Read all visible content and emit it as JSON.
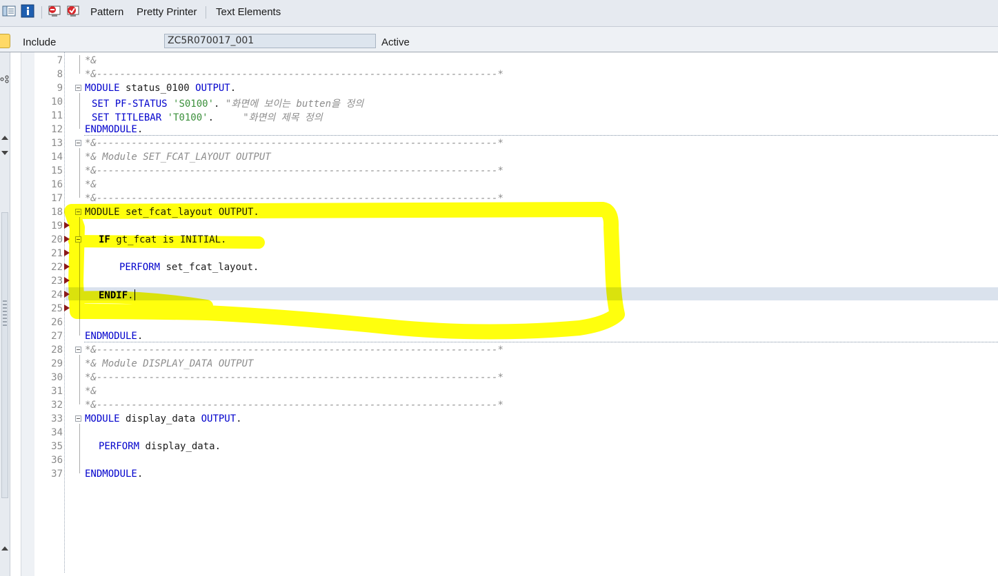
{
  "toolbar": {
    "icons": [
      "display-object-list-icon",
      "info-icon",
      "check-syntax-icon",
      "activate-icon"
    ],
    "pattern_label": "Pattern",
    "pretty_printer_label": "Pretty Printer",
    "text_elements_label": "Text Elements"
  },
  "header": {
    "include_label": "Include",
    "include_value": "ZC5R070017_001",
    "status": "Active"
  },
  "editor": {
    "lines": [
      {
        "num": "7"
      },
      {
        "num": "8"
      },
      {
        "num": "9"
      },
      {
        "num": "10"
      },
      {
        "num": "11"
      },
      {
        "num": "12"
      },
      {
        "num": "13"
      },
      {
        "num": "14"
      },
      {
        "num": "15"
      },
      {
        "num": "16"
      },
      {
        "num": "17"
      },
      {
        "num": "18"
      },
      {
        "num": "19"
      },
      {
        "num": "20"
      },
      {
        "num": "21"
      },
      {
        "num": "22"
      },
      {
        "num": "23"
      },
      {
        "num": "24"
      },
      {
        "num": "25"
      },
      {
        "num": "26"
      },
      {
        "num": "27"
      },
      {
        "num": "28"
      },
      {
        "num": "29"
      },
      {
        "num": "30"
      },
      {
        "num": "31"
      },
      {
        "num": "32"
      },
      {
        "num": "33"
      },
      {
        "num": "34"
      },
      {
        "num": "35"
      },
      {
        "num": "36"
      },
      {
        "num": "37"
      }
    ],
    "code": {
      "l7": "*&",
      "l8": "*&---------------------------------------------------------------------*",
      "l9_kw1": "MODULE",
      "l9_name": " status_0100 ",
      "l9_kw2": "OUTPUT",
      "l9_dot": ".",
      "l10_kw1": "SET",
      "l10_kw2": " PF-STATUS ",
      "l10_str": "'S0100'",
      "l10_dot": ". ",
      "l10_cmt": "\"화면에 보이는 butten을 정의",
      "l11_kw1": "SET",
      "l11_kw2": " TITLEBAR ",
      "l11_str": "'T0100'",
      "l11_dot": ".     ",
      "l11_cmt": "\"화면의 제목 정의",
      "l12": "ENDMODULE",
      "l12_dot": ".",
      "l13": "*&---------------------------------------------------------------------*",
      "l14": "*& Module SET_FCAT_LAYOUT OUTPUT",
      "l15": "*&---------------------------------------------------------------------*",
      "l16": "*&",
      "l17": "*&---------------------------------------------------------------------*",
      "l18": "MODULE set_fcat_layout OUTPUT.",
      "l20_kw": "IF",
      "l20_rest": " gt_fcat is INITIAL.",
      "l22_kw": "PERFORM",
      "l22_rest": " set_fcat_layout.",
      "l24_kw": "ENDIF",
      "l24_rest": ".",
      "l27": "ENDMODULE",
      "l27_dot": ".",
      "l28": "*&---------------------------------------------------------------------*",
      "l29": "*& Module DISPLAY_DATA OUTPUT",
      "l30": "*&---------------------------------------------------------------------*",
      "l31": "*&",
      "l32": "*&---------------------------------------------------------------------*",
      "l33_kw1": "MODULE",
      "l33_name": " display_data ",
      "l33_kw2": "OUTPUT",
      "l33_dot": ".",
      "l35_kw": "PERFORM",
      "l35_rest": " display_data.",
      "l37": "ENDMODULE",
      "l37_dot": "."
    }
  },
  "colors": {
    "keyword": "#0000cc",
    "string": "#3a8f3a",
    "comment": "#8c8c8c",
    "highlight": "#ffff00",
    "breakpoint_marker": "#8b1a1a"
  }
}
